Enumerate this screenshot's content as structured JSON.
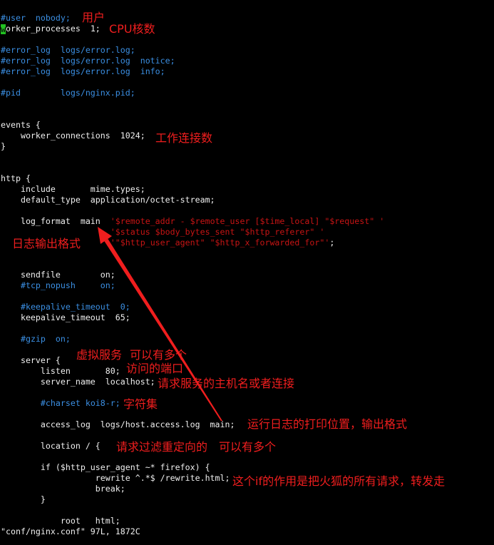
{
  "colors": {
    "background": "#000000",
    "text": "#f0f0f0",
    "comment": "#3b8fe3",
    "string": "#c81414",
    "annotation": "#f01e1e",
    "cursor": "#22c022"
  },
  "editor": {
    "lines": [
      {
        "segments": []
      },
      {
        "segments": [
          {
            "type": "comment",
            "text": "#user  nobody;"
          }
        ]
      },
      {
        "segments": [
          {
            "type": "cursor",
            "text": "w"
          },
          {
            "type": "code",
            "text": "orker_processes  1;"
          }
        ]
      },
      {
        "segments": []
      },
      {
        "segments": [
          {
            "type": "comment",
            "text": "#error_log  logs/error.log;"
          }
        ]
      },
      {
        "segments": [
          {
            "type": "comment",
            "text": "#error_log  logs/error.log  notice;"
          }
        ]
      },
      {
        "segments": [
          {
            "type": "comment",
            "text": "#error_log  logs/error.log  info;"
          }
        ]
      },
      {
        "segments": []
      },
      {
        "segments": [
          {
            "type": "comment",
            "text": "#pid        logs/nginx.pid;"
          }
        ]
      },
      {
        "segments": []
      },
      {
        "segments": []
      },
      {
        "segments": [
          {
            "type": "code",
            "text": "events {"
          }
        ]
      },
      {
        "segments": [
          {
            "type": "code",
            "text": "    worker_connections  1024;"
          }
        ]
      },
      {
        "segments": [
          {
            "type": "code",
            "text": "}"
          }
        ]
      },
      {
        "segments": []
      },
      {
        "segments": []
      },
      {
        "segments": [
          {
            "type": "code",
            "text": "http {"
          }
        ]
      },
      {
        "segments": [
          {
            "type": "code",
            "text": "    include       mime.types;"
          }
        ]
      },
      {
        "segments": [
          {
            "type": "code",
            "text": "    default_type  application/octet-stream;"
          }
        ]
      },
      {
        "segments": []
      },
      {
        "segments": [
          {
            "type": "code",
            "text": "    log_format  main  "
          },
          {
            "type": "string",
            "text": "'$remote_addr - $remote_user [$time_local] \"$request\" '"
          }
        ]
      },
      {
        "segments": [
          {
            "type": "code",
            "text": "                      "
          },
          {
            "type": "string",
            "text": "'$status $body_bytes_sent \"$http_referer\" '"
          }
        ]
      },
      {
        "segments": [
          {
            "type": "code",
            "text": "                      "
          },
          {
            "type": "string",
            "text": "'\"$http_user_agent\" \"$http_x_forwarded_for\"'"
          },
          {
            "type": "code",
            "text": ";"
          }
        ]
      },
      {
        "segments": []
      },
      {
        "segments": []
      },
      {
        "segments": [
          {
            "type": "code",
            "text": "    sendfile        on;"
          }
        ]
      },
      {
        "segments": [
          {
            "type": "code",
            "text": "    "
          },
          {
            "type": "comment",
            "text": "#tcp_nopush     on;"
          }
        ]
      },
      {
        "segments": []
      },
      {
        "segments": [
          {
            "type": "code",
            "text": "    "
          },
          {
            "type": "comment",
            "text": "#keepalive_timeout  0;"
          }
        ]
      },
      {
        "segments": [
          {
            "type": "code",
            "text": "    keepalive_timeout  65;"
          }
        ]
      },
      {
        "segments": []
      },
      {
        "segments": [
          {
            "type": "code",
            "text": "    "
          },
          {
            "type": "comment",
            "text": "#gzip  on;"
          }
        ]
      },
      {
        "segments": []
      },
      {
        "segments": [
          {
            "type": "code",
            "text": "    server {"
          }
        ]
      },
      {
        "segments": [
          {
            "type": "code",
            "text": "        listen       80;"
          }
        ]
      },
      {
        "segments": [
          {
            "type": "code",
            "text": "        server_name  localhost;"
          }
        ]
      },
      {
        "segments": []
      },
      {
        "segments": [
          {
            "type": "code",
            "text": "        "
          },
          {
            "type": "comment",
            "text": "#charset koi8-r;"
          }
        ]
      },
      {
        "segments": []
      },
      {
        "segments": [
          {
            "type": "code",
            "text": "        access_log  logs/host.access.log  main;"
          }
        ]
      },
      {
        "segments": []
      },
      {
        "segments": [
          {
            "type": "code",
            "text": "        location / {"
          }
        ]
      },
      {
        "segments": []
      },
      {
        "segments": [
          {
            "type": "code",
            "text": "        if ($http_user_agent ~* firefox) {"
          }
        ]
      },
      {
        "segments": [
          {
            "type": "code",
            "text": "                   rewrite ^.*$ /rewrite.html;"
          }
        ]
      },
      {
        "segments": [
          {
            "type": "code",
            "text": "                   break;"
          }
        ]
      },
      {
        "segments": [
          {
            "type": "code",
            "text": "        }"
          }
        ]
      },
      {
        "segments": []
      },
      {
        "segments": [
          {
            "type": "code",
            "text": "            root   html;"
          }
        ]
      }
    ]
  },
  "status_bar": {
    "message": "\"conf/nginx.conf\" 97L, 1872C"
  },
  "annotations": {
    "user": "用户",
    "cpu_cores": "CPU核数",
    "worker_connections": "工作连接数",
    "log_format": "日志输出格式",
    "virtual_server": [
      "虚拟服务",
      "可以有多个"
    ],
    "listen_port": "访问的端口",
    "server_name": "请求服务的主机名或者连接",
    "charset": "字符集",
    "access_log": "运行日志的打印位置，输出格式",
    "location": [
      "请求过滤重定向的",
      "可以有多个"
    ],
    "if_rule": "这个if的作用是把火狐的所有请求，转发走"
  }
}
